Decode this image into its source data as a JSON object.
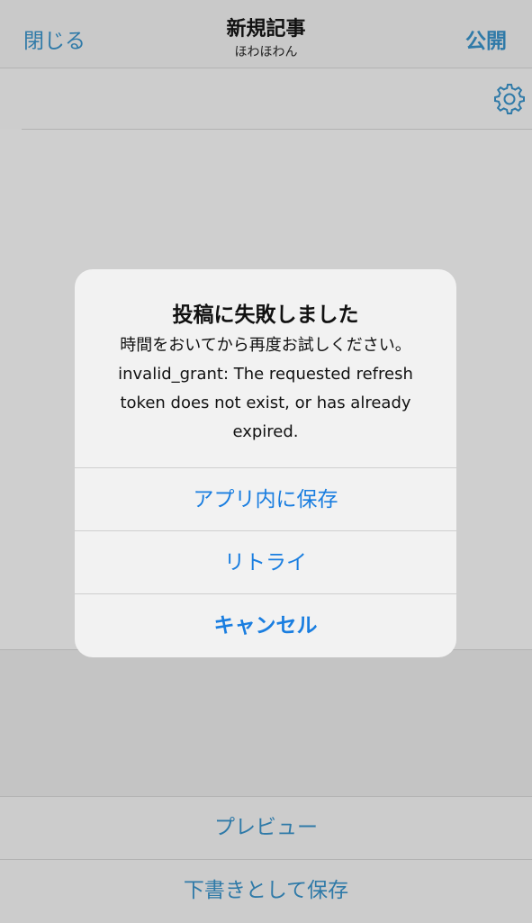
{
  "navbar": {
    "close_label": "閉じる",
    "title": "新規記事",
    "subtitle": "ほわほわん",
    "publish_label": "公開",
    "settings_icon": "gear-icon"
  },
  "toolbar": {
    "preview_label": "プレビュー",
    "save_draft_label": "下書きとして保存"
  },
  "alert": {
    "title": "投稿に失敗しました",
    "message_line1": "時間をおいてから再度お試しください。",
    "message_line2": "invalid_grant: The requested refresh",
    "message_line3": "token does not exist, or has already",
    "message_line4": "expired.",
    "save_in_app_label": "アプリ内に保存",
    "retry_label": "リトライ",
    "cancel_label": "キャンセル"
  },
  "colors": {
    "accent_nav": "#2f7aa8",
    "alert_button": "#1a7ee0"
  }
}
